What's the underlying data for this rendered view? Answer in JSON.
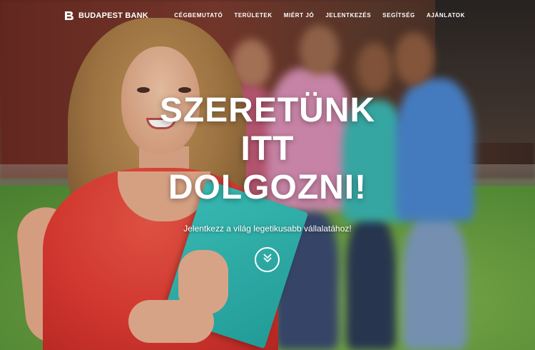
{
  "header": {
    "logo_text": "BUDAPEST BANK",
    "nav_items": [
      {
        "label": "CÉGBEMUTATÓ"
      },
      {
        "label": "TERÜLETEK"
      },
      {
        "label": "MIÉRT JÓ"
      },
      {
        "label": "JELENTKEZÉS"
      },
      {
        "label": "SEGÍTSÉG"
      },
      {
        "label": "AJÁNLATOK"
      }
    ]
  },
  "hero": {
    "headline_lines": [
      "SZERETÜNK",
      "ITT",
      "DOLGOZNI!"
    ],
    "subtitle": "Jelentkezz a világ legetikusabb vállalatához!",
    "scroll_icon": "chevron-double-down-icon"
  },
  "colors": {
    "text": "#ffffff",
    "shirt": "#e23b33",
    "notebook": "#3ec9c2"
  }
}
